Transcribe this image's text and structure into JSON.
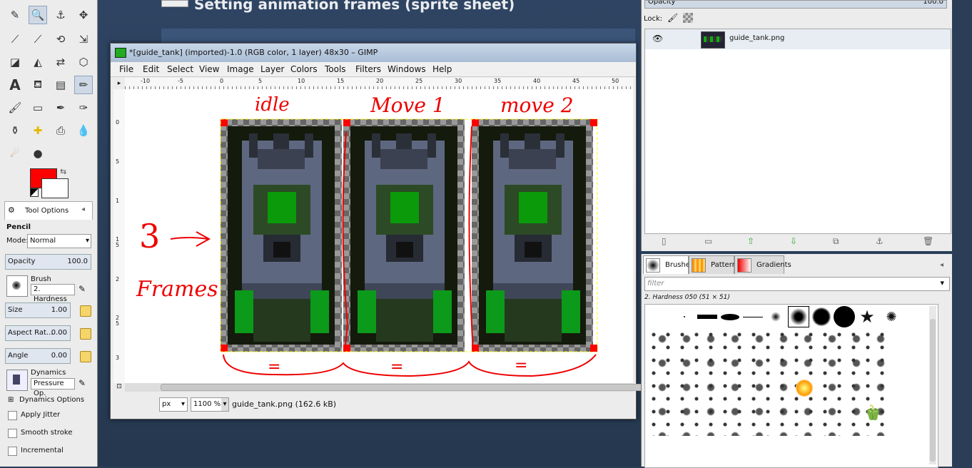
{
  "desktop": {
    "heading": "Setting animation frames (sprite sheet)"
  },
  "toolbox": {
    "tool_options_tab": "Tool Options",
    "tool_name": "Pencil",
    "mode_label": "Mode:",
    "mode_value": "Normal",
    "opacity_label": "Opacity",
    "opacity_value": "100.0",
    "brush_label": "Brush",
    "brush_value": "2. Hardness",
    "size_label": "Size",
    "size_value": "1.00",
    "aspect_label": "Aspect Rat...",
    "aspect_value": "0.00",
    "angle_label": "Angle",
    "angle_value": "0.00",
    "dynamics_label": "Dynamics",
    "dynamics_value": "Pressure Op.",
    "dynamics_options": "Dynamics Options",
    "apply_jitter": "Apply Jitter",
    "smooth_stroke": "Smooth stroke",
    "incremental": "Incremental",
    "fg_color": "#ff0000",
    "bg_color": "#ffffff"
  },
  "image_window": {
    "title": "*[guide_tank] (imported)-1.0 (RGB color, 1 layer) 48x30 – GIMP",
    "menus": [
      "File",
      "Edit",
      "Select",
      "View",
      "Image",
      "Layer",
      "Colors",
      "Tools",
      "Filters",
      "Windows",
      "Help"
    ],
    "ruler_h": [
      "-10",
      "-5",
      "0",
      "5",
      "10",
      "15",
      "20",
      "25",
      "30",
      "35",
      "40",
      "45",
      "50"
    ],
    "ruler_v": [
      "0",
      "5",
      "1",
      "1\n5",
      "2",
      "2\n5",
      "3"
    ],
    "annotations": {
      "frame1": "idle",
      "frame2": "Move 1",
      "frame3": "move 2",
      "count": "3",
      "frames": "Frames",
      "eq": "="
    },
    "status": {
      "unit": "px",
      "zoom": "1100 %",
      "file": "guide_tank.png (162.6 kB)"
    }
  },
  "layers": {
    "opacity_label": "Opacity",
    "opacity_value": "100.0",
    "lock_label": "Lock:",
    "layer_name": "guide_tank.png"
  },
  "brushes": {
    "tabs": [
      "Brushes",
      "Patterns",
      "Gradients"
    ],
    "filter_placeholder": "filter",
    "selected": "2. Hardness 050 (51 × 51)"
  }
}
